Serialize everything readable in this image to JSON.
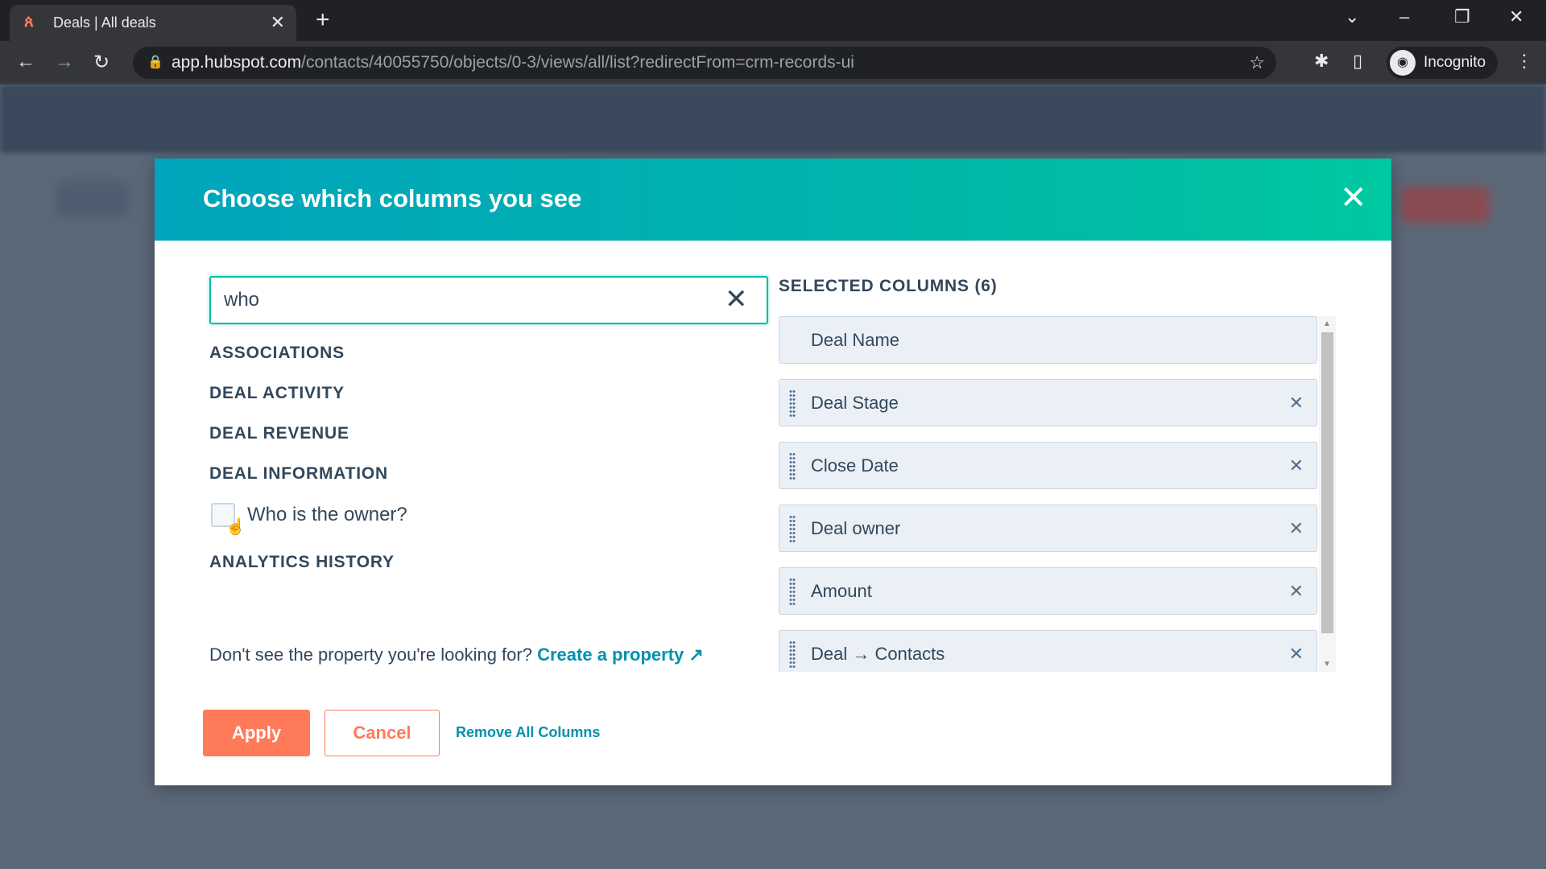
{
  "browser": {
    "tab_title": "Deals | All deals",
    "url_host": "app.hubspot.com",
    "url_path": "/contacts/40055750/objects/0-3/views/all/list?redirectFrom=crm-records-ui",
    "profile_label": "Incognito"
  },
  "modal": {
    "title": "Choose which columns you see",
    "search": {
      "value": "who",
      "placeholder": ""
    },
    "sections": [
      "ASSOCIATIONS",
      "DEAL ACTIVITY",
      "DEAL REVENUE",
      "DEAL INFORMATION",
      "ANALYTICS HISTORY"
    ],
    "option": {
      "label": "Who is the owner?",
      "checked": false
    },
    "footer_text": "Don't see the property you're looking for?",
    "create_link": "Create a property",
    "selected_header": "SELECTED COLUMNS (6)",
    "selected": [
      "Deal Name",
      "Deal Stage",
      "Close Date",
      "Deal owner",
      "Amount",
      "Deal → Contacts"
    ],
    "apply_label": "Apply",
    "cancel_label": "Cancel",
    "remove_all_label": "Remove All Columns"
  },
  "colors": {
    "header_start": "#00a4bd",
    "header_end": "#00bda5",
    "primary": "#ff7a59",
    "link": "#0091ae"
  }
}
